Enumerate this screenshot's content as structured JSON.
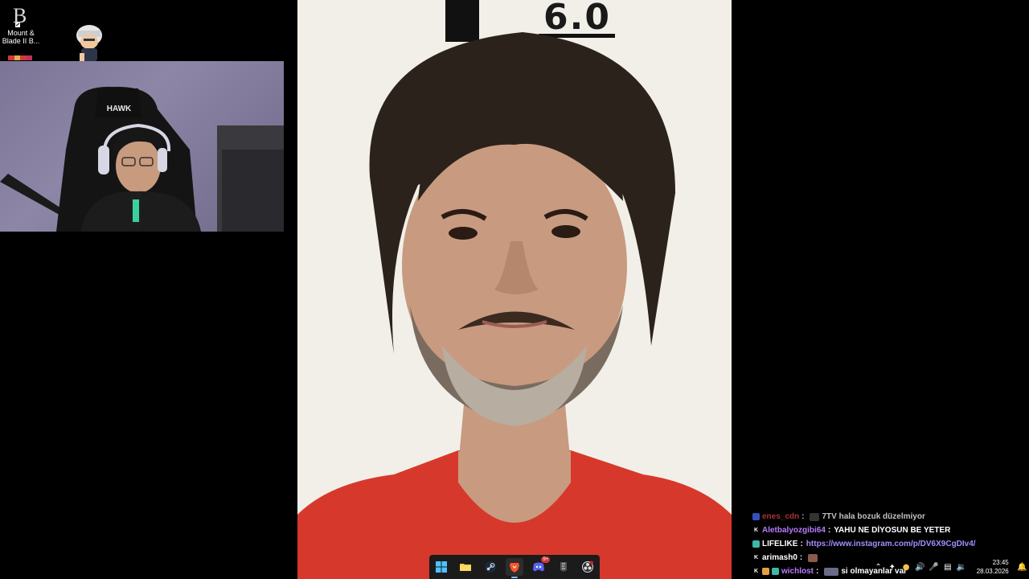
{
  "desktop": {
    "icon_label": "Mount & Blade II B..."
  },
  "photo": {
    "height_marker": "6.0"
  },
  "chat": {
    "lines": [
      {
        "badge_color": "#4b6bff",
        "user": "enes_cdn",
        "user_color": "#e04545",
        "sep": ":",
        "message": "7TV hala bozuk düzelmiyor"
      },
      {
        "badge_color": "#ffffff",
        "user": "Aletbalyozgibi64",
        "user_color": "#b77cff",
        "sep": ":",
        "message": "YAHU NE DİYOSUN BE YETER"
      },
      {
        "badge_color": "#3fb8a8",
        "user": "LIFELIKE",
        "user_color": "#ffffff",
        "sep": ":",
        "message": "https://www.instagram.com/p/DV6X9CgDIv4/"
      },
      {
        "badge_color": "#ffffff",
        "user": "arimash0",
        "user_color": "#ffffff",
        "sep": ":",
        "message": ""
      },
      {
        "badge_color": "#ffffff",
        "user": "wichlost",
        "user_color": "#b77cff",
        "sep": ":",
        "message": "si olmayanlar var"
      }
    ]
  },
  "taskbar": {
    "items": [
      "start",
      "file-explorer",
      "steam",
      "brave",
      "discord",
      "epic-games",
      "obs"
    ],
    "discord_badge": "9+"
  },
  "tray": {
    "time": "23:45",
    "date": "28.03.2026"
  },
  "colors": {
    "shirt": "#d6392b",
    "wall": "#f1efe8",
    "webcam_bg": "#8d86a6",
    "taskbar_bg": "#1b1b1b",
    "link": "#a58cff"
  }
}
